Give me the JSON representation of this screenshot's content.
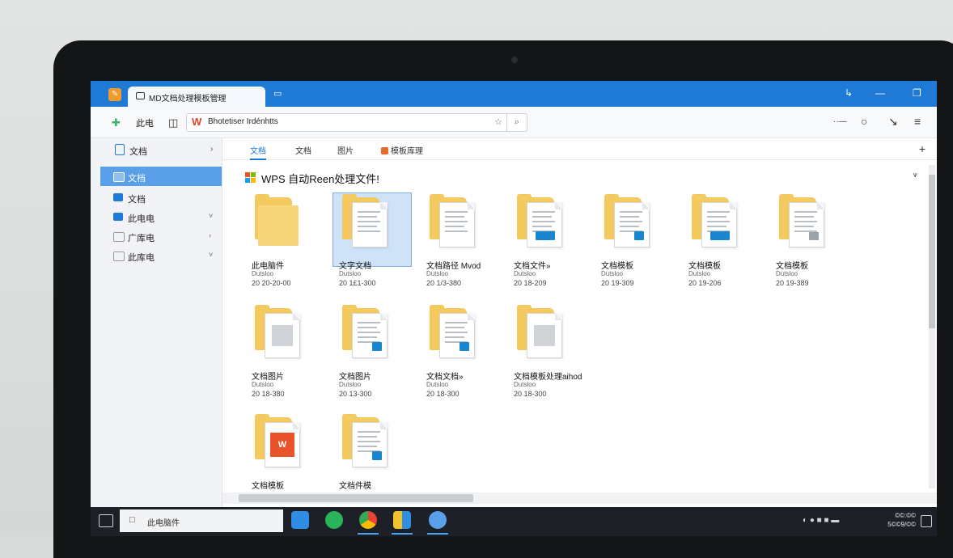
{
  "window": {
    "tab_title": "MD文档处理模板管理",
    "new_tab_symbol": "▭",
    "minimize_symbol": "—",
    "restore_symbol": "❐",
    "settings_symbol": "↳"
  },
  "toolbar": {
    "nav_label": "此电",
    "url_text": "Bhotetiser Irdénhtts",
    "url_star": "☆",
    "search_symbol": "⌕",
    "more_symbol": "··—",
    "circle_symbol": "○",
    "pen_symbol": "↘",
    "menu_symbol": "≡"
  },
  "sidebar": {
    "header": "文档",
    "header_chevron": "›",
    "items": [
      {
        "label": "文档",
        "active": true,
        "chevron": ""
      },
      {
        "label": "文档",
        "active": false,
        "chevron": ""
      },
      {
        "label": "此电电",
        "active": false,
        "chevron": "˅"
      },
      {
        "label": "广库电",
        "active": false,
        "chevron": "›"
      },
      {
        "label": "此库电",
        "active": false,
        "chevron": "˅"
      }
    ]
  },
  "ribbon": {
    "tabs": [
      "文档",
      "文档",
      "图片",
      "模板库理"
    ],
    "active_index": 0,
    "plus": "+"
  },
  "content": {
    "heading": "WPS 自动Reen处理文件!",
    "filter_symbol": "⩛",
    "files": [
      {
        "name": "此电脑件",
        "sub": "Dutsloo",
        "date": "20 20-20-00",
        "type": "folder",
        "selected": false
      },
      {
        "name": "文字文档",
        "sub": "Dutsloo",
        "date": "20 1£1-300",
        "type": "doc",
        "selected": true
      },
      {
        "name": "文档路径 Mvod",
        "sub": "Dutsloo",
        "date": "20 1/3-380",
        "type": "doc",
        "selected": false
      },
      {
        "name": "文档文件»",
        "sub": "Dutsloo",
        "date": "20 18-209",
        "type": "doc-badge",
        "selected": false
      },
      {
        "name": "文档模板",
        "sub": "Dutsloo",
        "date": "20 19-309",
        "type": "doc-badge-sm",
        "selected": false
      },
      {
        "name": "文档模板",
        "sub": "Dutsloo",
        "date": "20 19-206",
        "type": "doc-badge",
        "selected": false
      },
      {
        "name": "文档模板",
        "sub": "Dutsloo",
        "date": "20 19-389",
        "type": "doc-gray",
        "selected": false
      },
      {
        "name": "文档图片",
        "sub": "Dutsloo",
        "date": "20 18-380",
        "type": "image",
        "selected": false
      },
      {
        "name": "文档图片",
        "sub": "Dutsloo",
        "date": "20 13-300",
        "type": "doc-badge-sm",
        "selected": false
      },
      {
        "name": "文档文档»",
        "sub": "Dutsloo",
        "date": "20 18-300",
        "type": "doc-badge-sm",
        "selected": false
      },
      {
        "name": "文档模板处理aihod",
        "sub": "Dutsloo",
        "date": "20 18-300",
        "type": "image-plain",
        "selected": false
      },
      {
        "name": "文档模板",
        "sub": "",
        "date": "",
        "type": "wps",
        "selected": false
      },
      {
        "name": "文档件模",
        "sub": "",
        "date": "",
        "type": "doc-badge-sm",
        "selected": false
      }
    ]
  },
  "taskbar": {
    "search_text": "此电脑件",
    "search_icon": "□",
    "tray_icons": "◐ ● ■ ■ ▬",
    "clock_time": "©©:©©",
    "clock_date": "5©©9/©©"
  },
  "colors": {
    "titlebar": "#1f7ad6",
    "accent": "#5aa0e8",
    "folder": "#f4c95d",
    "badge": "#1a86d0",
    "wps_red": "#e8532a"
  }
}
